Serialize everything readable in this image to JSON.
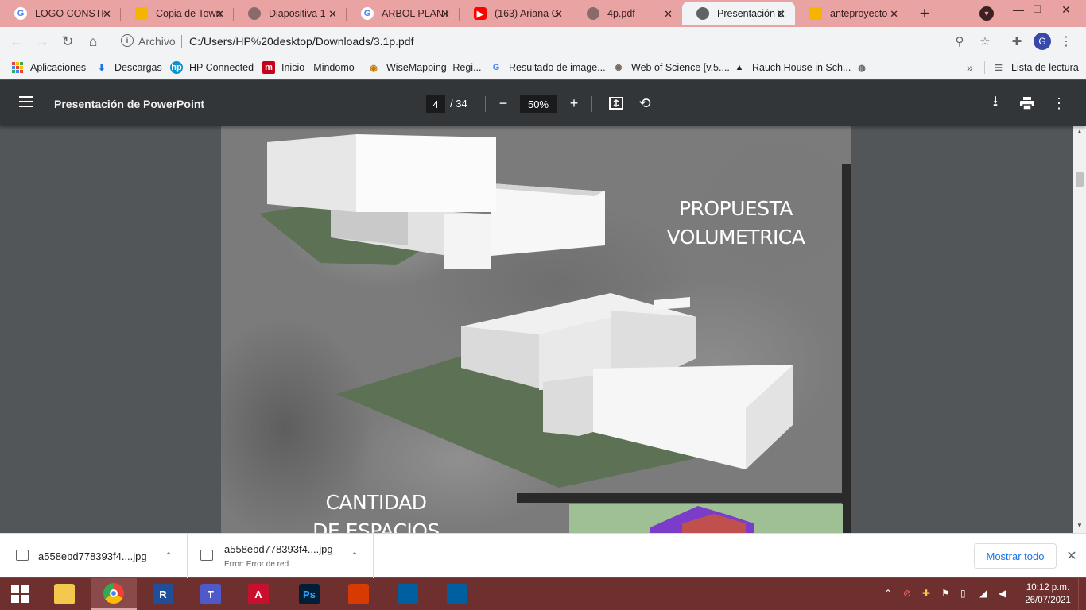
{
  "browser": {
    "tabs": [
      {
        "title": "LOGO CONSTR",
        "icon": "google-icon",
        "active": false
      },
      {
        "title": "Copia de Town",
        "icon": "slides-icon",
        "active": false
      },
      {
        "title": "Diapositiva 1",
        "icon": "globe-icon",
        "active": false
      },
      {
        "title": "ARBOL PLANT",
        "icon": "google-icon",
        "active": false
      },
      {
        "title": "(163) Ariana G",
        "icon": "youtube-icon",
        "active": false
      },
      {
        "title": "4p.pdf",
        "icon": "globe-icon",
        "active": false
      },
      {
        "title": "Presentación d",
        "icon": "globe-icon",
        "active": true
      },
      {
        "title": "anteproyecto",
        "icon": "slides-icon",
        "active": false
      }
    ],
    "new_tab": "+",
    "address": {
      "scheme_label": "Archivo",
      "url": "C:/Users/HP%20desktop/Downloads/3.1p.pdf"
    },
    "profile_initial": "G",
    "bookmarks": [
      {
        "label": "Aplicaciones",
        "icon": "apps-grid-icon"
      },
      {
        "label": "Descargas",
        "icon": "download-icon"
      },
      {
        "label": "HP Connected",
        "icon": "hp-icon"
      },
      {
        "label": "Inicio - Mindomo",
        "icon": "mindomo-icon"
      },
      {
        "label": "WiseMapping- Regi...",
        "icon": "wisemapping-icon"
      },
      {
        "label": "Resultado de image...",
        "icon": "google-icon"
      },
      {
        "label": "Web of Science [v.5....",
        "icon": "wos-icon"
      },
      {
        "label": "Rauch House in Sch...",
        "icon": "rauch-icon"
      }
    ],
    "more_bookmarks": "»",
    "reading_list": "Lista de lectura"
  },
  "pdf_viewer": {
    "title": "Presentación de PowerPoint",
    "current_page": "4",
    "total_pages": "/ 34",
    "zoom": "50%"
  },
  "page_content": {
    "heading_1_line_1": "PROPUESTA",
    "heading_1_line_2": "VOLUMETRICA",
    "heading_2_line_1": "CANTIDAD",
    "heading_2_line_2": "DE ESPACIOS"
  },
  "downloads": {
    "items": [
      {
        "name": "a558ebd778393f4....jpg",
        "status": ""
      },
      {
        "name": "a558ebd778393f4....jpg",
        "status": "Error: Error de red"
      }
    ],
    "show_all": "Mostrar todo"
  },
  "taskbar": {
    "apps": [
      {
        "name": "file-explorer",
        "label": ""
      },
      {
        "name": "chrome",
        "label": ""
      },
      {
        "name": "revit",
        "label": "R"
      },
      {
        "name": "teams",
        "label": "T"
      },
      {
        "name": "autocad",
        "label": "A"
      },
      {
        "name": "photoshop",
        "label": "Ps"
      },
      {
        "name": "office",
        "label": ""
      },
      {
        "name": "sketchup",
        "label": ""
      },
      {
        "name": "sketchup-2",
        "label": ""
      }
    ],
    "time": "10:12 p.m.",
    "date": "26/07/2021"
  },
  "colors": {
    "tabstrip": "#e9a3a3",
    "pdf_toolbar": "#323639",
    "viewer_bg": "#525659",
    "taskbar": "#6e2f2f",
    "link_blue": "#1a73e8"
  }
}
